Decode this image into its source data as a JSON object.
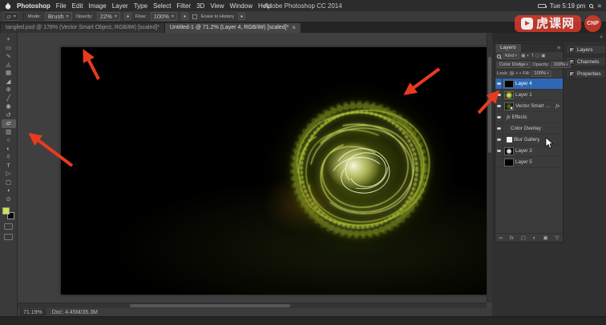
{
  "menu_bar": {
    "app_name": "Photoshop",
    "items": [
      "File",
      "Edit",
      "Image",
      "Layer",
      "Type",
      "Select",
      "Filter",
      "3D",
      "View",
      "Window",
      "Help"
    ],
    "window_title": "Adobe Photoshop CC 2014",
    "clock": "Tue 5:19 pm"
  },
  "options_bar": {
    "preset_tool": "Eraser",
    "mode_label": "Mode:",
    "mode_value": "Brush",
    "opacity_label": "Opacity:",
    "opacity_value": "22%",
    "flow_label": "Flow:",
    "flow_value": "100%",
    "erase_history_label": "Erase to History"
  },
  "document_tabs": [
    {
      "label": "tangled.psd @ 178% (Vector Smart Object, RGB/8#) [scaled]*",
      "active": false
    },
    {
      "label": "Untitled-1 @ 71.2% (Layer 4, RGB/8#) [scaled]*",
      "active": true,
      "close": "×"
    }
  ],
  "toolbar": {
    "tools": [
      {
        "name": "move-tool",
        "glyph": "+"
      },
      {
        "name": "marquee-tool",
        "glyph": "▭"
      },
      {
        "name": "lasso-tool",
        "glyph": "∿"
      },
      {
        "name": "quick-selection-tool",
        "glyph": "◬"
      },
      {
        "name": "crop-tool",
        "glyph": "▦"
      },
      {
        "name": "eyedropper-tool",
        "glyph": "◢"
      },
      {
        "name": "healing-brush-tool",
        "glyph": "⊕"
      },
      {
        "name": "brush-tool",
        "glyph": "╱"
      },
      {
        "name": "clone-stamp-tool",
        "glyph": "◉"
      },
      {
        "name": "history-brush-tool",
        "glyph": "↺"
      },
      {
        "name": "eraser-tool",
        "glyph": "▱",
        "active": true
      },
      {
        "name": "gradient-tool",
        "glyph": "▧"
      },
      {
        "name": "blur-tool",
        "glyph": "○"
      },
      {
        "name": "dodge-tool",
        "glyph": "◐"
      },
      {
        "name": "pen-tool",
        "glyph": "◊"
      },
      {
        "name": "type-tool",
        "glyph": "T"
      },
      {
        "name": "path-selection-tool",
        "glyph": "▷"
      },
      {
        "name": "shape-tool",
        "glyph": "▢"
      },
      {
        "name": "hand-tool",
        "glyph": "◖"
      },
      {
        "name": "zoom-tool",
        "glyph": "⊙"
      }
    ]
  },
  "layers_panel": {
    "tab": "Layers",
    "filter_label": "Kind",
    "filter_icons": [
      {
        "name": "pixel-layer-filter-icon",
        "glyph": "▦"
      },
      {
        "name": "adjustment-layer-filter-icon",
        "glyph": "◐"
      },
      {
        "name": "type-layer-filter-icon",
        "glyph": "T"
      },
      {
        "name": "shape-layer-filter-icon",
        "glyph": "▢"
      },
      {
        "name": "smart-object-filter-icon",
        "glyph": "▣"
      }
    ],
    "blend_mode": "Color Dodge",
    "opacity_label": "Opacity:",
    "opacity_value": "100%",
    "lock_label": "Lock:",
    "lock_icons": [
      {
        "name": "lock-transparency-icon",
        "glyph": "▨"
      },
      {
        "name": "lock-position-icon",
        "glyph": "+"
      },
      {
        "name": "lock-all-icon",
        "glyph": "▪"
      }
    ],
    "fill_label": "Fill:",
    "fill_value": "100%",
    "rows": [
      {
        "name": "Layer 4",
        "type": "layer",
        "thumb": "black",
        "eye": true,
        "selected": true
      },
      {
        "name": "Layer 1",
        "type": "layer",
        "thumb": "green",
        "eye": true
      },
      {
        "name": "Vector Smart Object",
        "type": "smart-object",
        "thumb": "dark",
        "eye": true,
        "fx": "fx"
      },
      {
        "name": "Effects",
        "type": "effects",
        "eye": true,
        "indent": 1
      },
      {
        "name": "Color Overlay",
        "type": "effect-item",
        "eye": true,
        "indent": 2
      },
      {
        "name": "Blur Gallery",
        "type": "smart-filter",
        "eye": true,
        "indent": 1
      },
      {
        "name": "Layer 3",
        "type": "layer",
        "thumb": "blob",
        "eye": true
      },
      {
        "name": "Layer 5",
        "type": "layer",
        "thumb": "black",
        "eye": false
      }
    ],
    "footer_icons": [
      {
        "name": "link-layers-icon",
        "glyph": "∞"
      },
      {
        "name": "layer-style-icon",
        "glyph": "fx"
      },
      {
        "name": "layer-mask-icon",
        "glyph": "▢"
      },
      {
        "name": "adjustment-layer-icon",
        "glyph": "◐"
      },
      {
        "name": "new-layer-icon",
        "glyph": "▣"
      },
      {
        "name": "delete-layer-icon",
        "glyph": "▽"
      }
    ]
  },
  "right_dock": {
    "panels": [
      {
        "name": "panel-layers",
        "label": "Layers"
      },
      {
        "name": "panel-channels",
        "label": "Channels"
      },
      {
        "name": "panel-properties",
        "label": "Properties"
      }
    ]
  },
  "status_bar": {
    "zoom": "71.19%",
    "doc_info": "Doc: 4.45M/35.3M"
  },
  "watermark": {
    "text": "虎课网",
    "badge": "CNP"
  },
  "colors": {
    "arrow": "#e83b1e",
    "selection": "#2e68b5",
    "foreground_swatch": "#cfe24e",
    "background_swatch": "#060606",
    "orb_core": "#ffffe9",
    "orb_strands": "#cde24a",
    "orb_glow": "#55660a"
  }
}
